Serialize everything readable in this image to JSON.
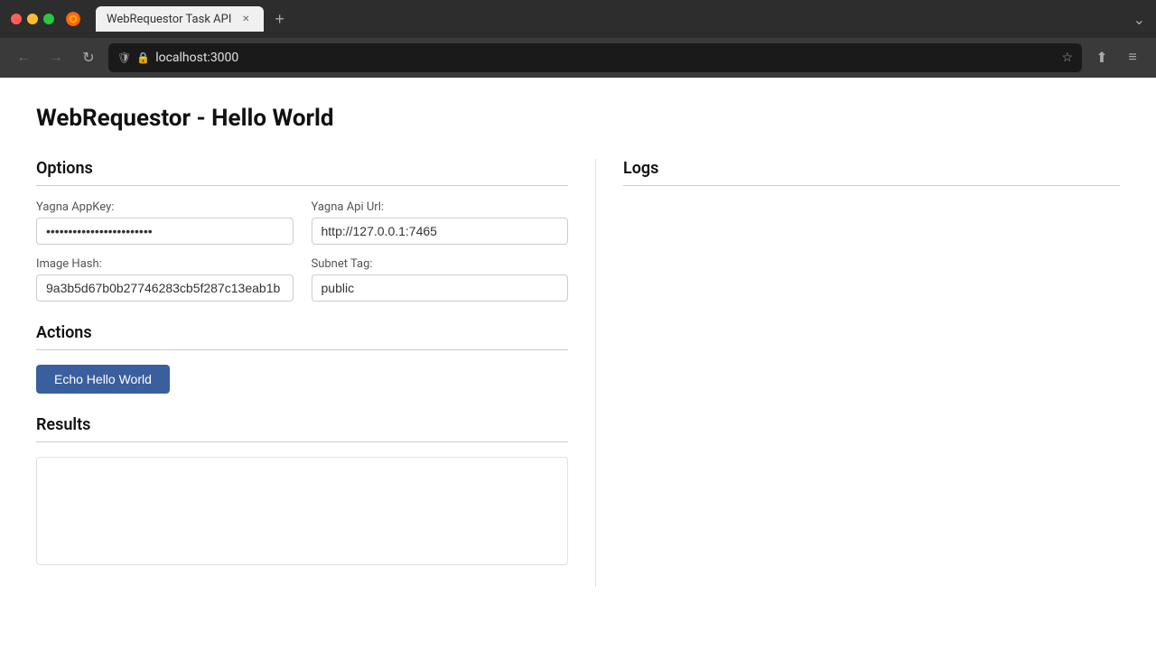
{
  "browser": {
    "tab_title": "WebRequestor Task API",
    "url": "localhost:3000",
    "new_tab_label": "+",
    "overflow_label": "⌄"
  },
  "page": {
    "title": "WebRequestor - Hello World"
  },
  "options": {
    "section_title": "Options",
    "appkey_label": "Yagna AppKey:",
    "appkey_value": "************************",
    "api_url_label": "Yagna Api Url:",
    "api_url_value": "http://127.0.0.1:7465",
    "image_hash_label": "Image Hash:",
    "image_hash_value": "9a3b5d67b0b27746283cb5f287c13eab1b",
    "subnet_tag_label": "Subnet Tag:",
    "subnet_tag_value": "public"
  },
  "actions": {
    "section_title": "Actions",
    "echo_button_label": "Echo Hello World"
  },
  "results": {
    "section_title": "Results"
  },
  "logs": {
    "section_title": "Logs"
  }
}
